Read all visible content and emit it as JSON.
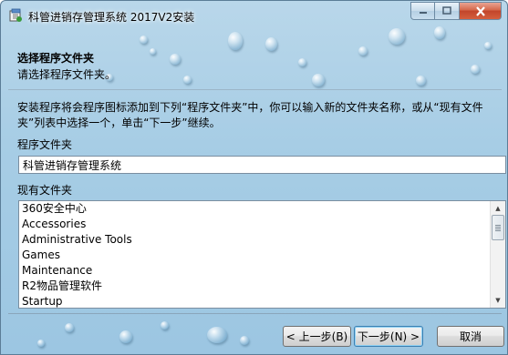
{
  "window": {
    "title": "科管进销存管理系统 2017V2安装"
  },
  "header": {
    "title": "选择程序文件夹",
    "subtitle": "请选择程序文件夹。"
  },
  "content": {
    "description": "安装程序将会程序图标添加到下列“程序文件夹”中，你可以输入新的文件夹名称，或从“现有文件夹”列表中选择一个，单击“下一步”继续。",
    "program_folder_label": "程序文件夹",
    "program_folder_value": "科管进销存管理系统",
    "existing_folders_label": "现有文件夹",
    "existing_folders": [
      "360安全中心",
      "Accessories",
      "Administrative Tools",
      "Games",
      "Maintenance",
      "R2物品管理软件",
      "Startup"
    ]
  },
  "buttons": {
    "back": "< 上一步(B)",
    "next": "下一步(N) >",
    "cancel": "取消"
  },
  "colors": {
    "background_accent": "#a7cde5",
    "close_button": "#c2452a"
  },
  "icons": {
    "app": "installer-icon",
    "minimize": "minimize-icon",
    "maximize": "maximize-icon",
    "close": "close-icon",
    "scroll_up": "scroll-up-arrow-icon",
    "scroll_down": "scroll-down-arrow-icon"
  }
}
